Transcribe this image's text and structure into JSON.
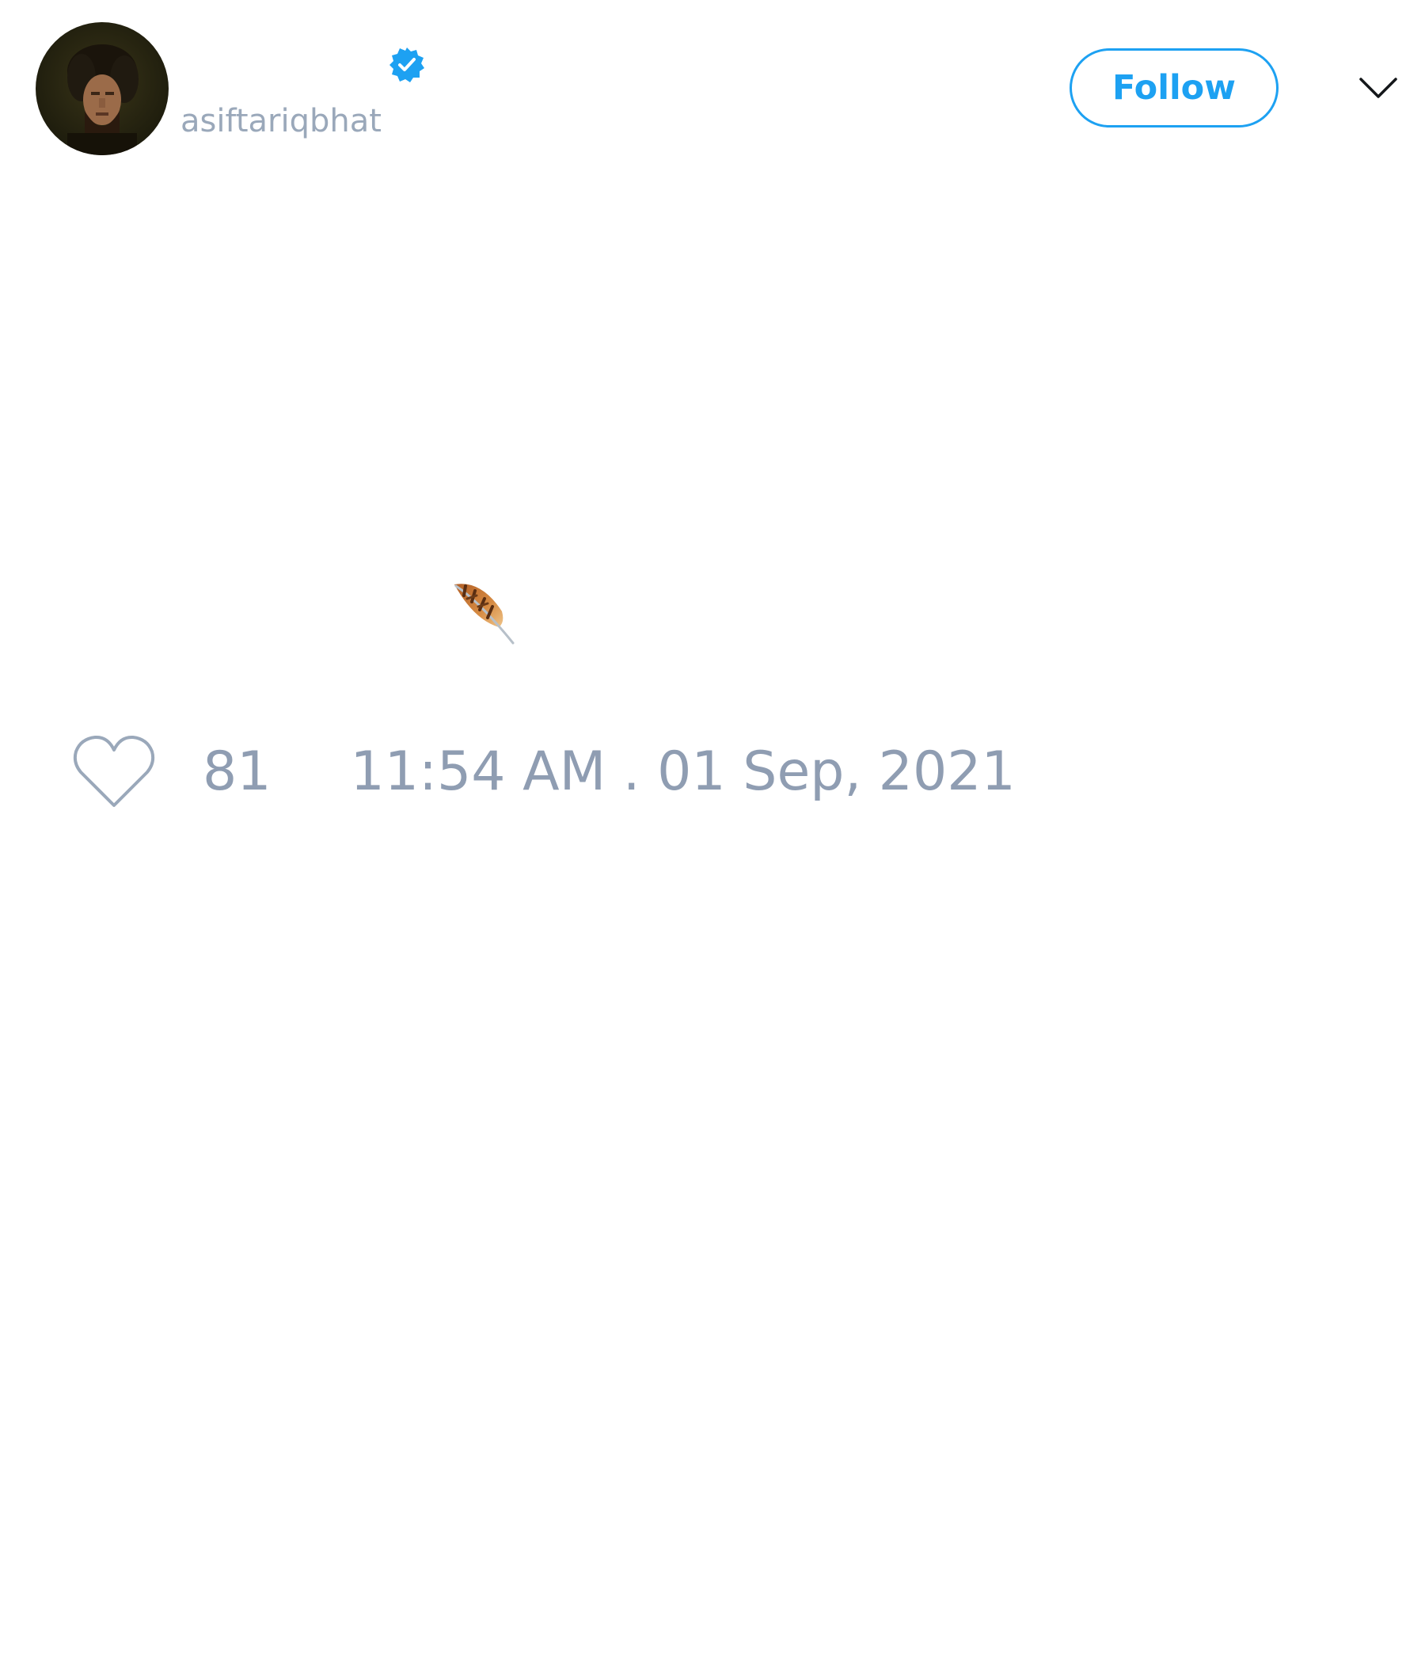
{
  "tweet": {
    "author": {
      "display_name": "",
      "handle": "asiftariqbhat",
      "verified": true
    },
    "follow_label": "Follow",
    "body_text": "",
    "emoji": "feather",
    "likes": "81",
    "timestamp": "11:54 AM . 01 Sep, 2021"
  },
  "icons": {
    "verified": "verified-badge-icon",
    "menu": "chevron-down-icon",
    "like": "heart-icon",
    "emoji": "feather-icon"
  },
  "colors": {
    "accent": "#1da1f2",
    "muted_text": "#9aa8ba",
    "footer_text": "#8f9db2",
    "background": "#ffffff"
  }
}
